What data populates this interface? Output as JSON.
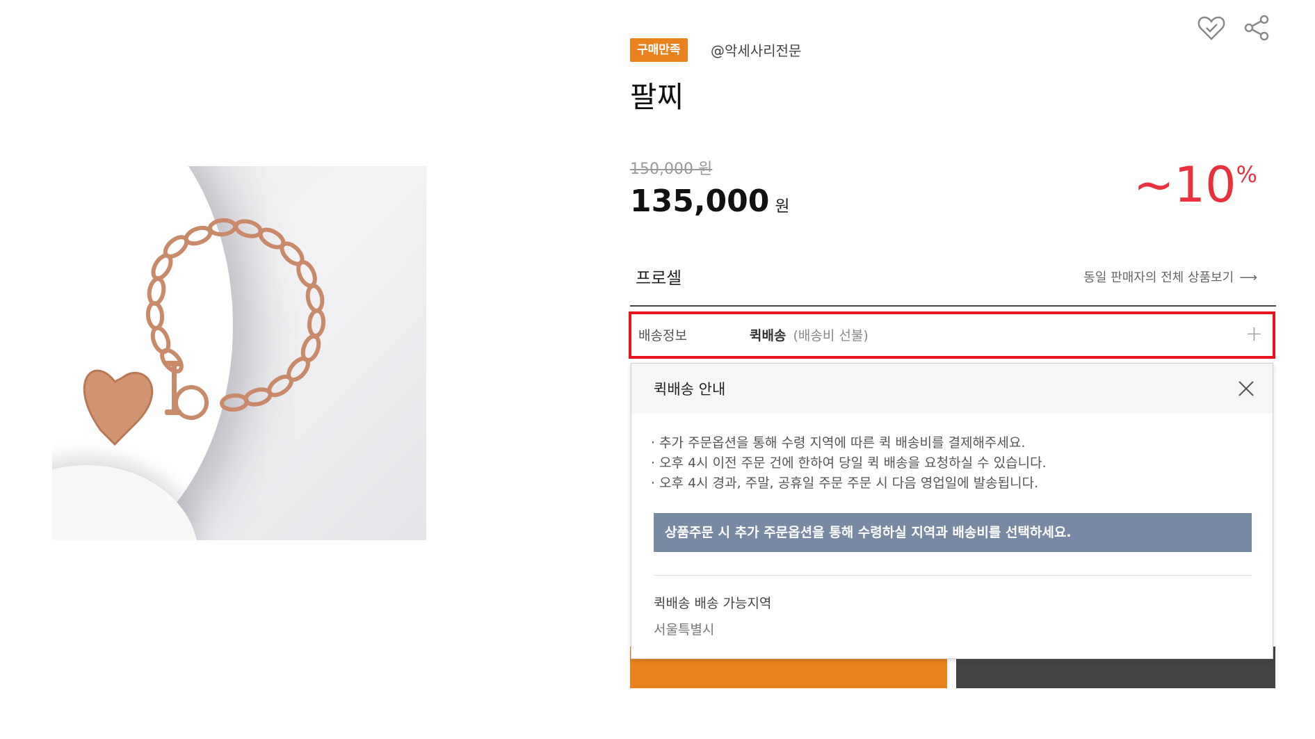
{
  "product": {
    "badge": "구매만족",
    "seller_handle": "@악세사리전문",
    "title": "팔찌",
    "price_original": "150,000 원",
    "price_current": "135,000",
    "price_unit": "원",
    "discount_value": "~10",
    "discount_unit": "%"
  },
  "seller": {
    "name": "프로셀",
    "all_products_link": "동일 판매자의 전체 상품보기"
  },
  "shipping": {
    "label": "배송정보",
    "method": "퀵배송",
    "note": "(배송비 선불)"
  },
  "popup": {
    "title": "퀵배송 안내",
    "notices": [
      "· 추가 주문옵션을 통해 수령 지역에 따른 퀵 배송비를 결제해주세요.",
      "· 오후 4시 이전 주문 건에 한하여 당일 퀵 배송을 요청하실 수 있습니다.",
      "· 오후 4시 경과, 주말, 공휴일 주문 주문 시 다음 영업일에 발송됩니다."
    ],
    "banner": "상품주문 시 추가 주문옵션을 통해 수령하실 지역과 배송비를 선택하세요.",
    "area_title": "퀵배송 배송 가능지역",
    "area_value": "서울특별시"
  },
  "icons": {
    "wishlist": "heart-check-icon",
    "share": "share-icon",
    "close": "close-icon",
    "expand": "plus-icon",
    "arrow": "arrow-right-icon"
  },
  "colors": {
    "badge": "#e8821e",
    "discount": "#e8313d",
    "highlight_border": "#e8141e",
    "banner": "#7889a3",
    "cart_button": "#e8821e",
    "buy_button": "#444444"
  }
}
